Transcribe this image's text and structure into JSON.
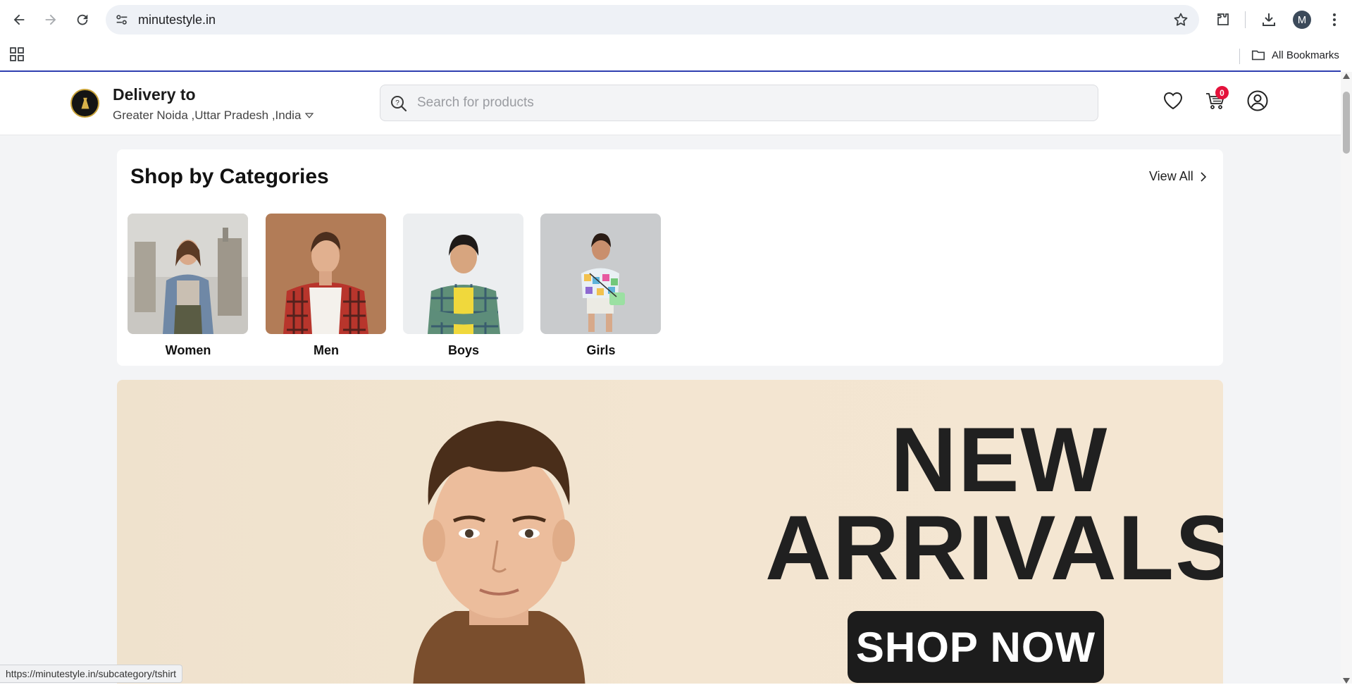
{
  "browser": {
    "url": "minutestyle.in",
    "profile_initial": "M",
    "bookmarks_label": "All Bookmarks",
    "status_url": "https://minutestyle.in/subcategory/tshirt"
  },
  "header": {
    "delivery_title": "Delivery to",
    "delivery_location": "Greater Noida ,Uttar Pradesh ,India",
    "search_placeholder": "Search for products",
    "cart_count": "0"
  },
  "categories": {
    "heading": "Shop by Categories",
    "view_all": "View All",
    "items": [
      {
        "label": "Women"
      },
      {
        "label": "Men"
      },
      {
        "label": "Boys"
      },
      {
        "label": "Girls"
      }
    ]
  },
  "banner": {
    "line1": "NEW",
    "line2": "ARRIVALS",
    "cta": "SHOP NOW"
  },
  "colors": {
    "accent_badge": "#e4123b",
    "banner_bg": "#f3e5d1",
    "page_bg": "#f3f4f6"
  }
}
